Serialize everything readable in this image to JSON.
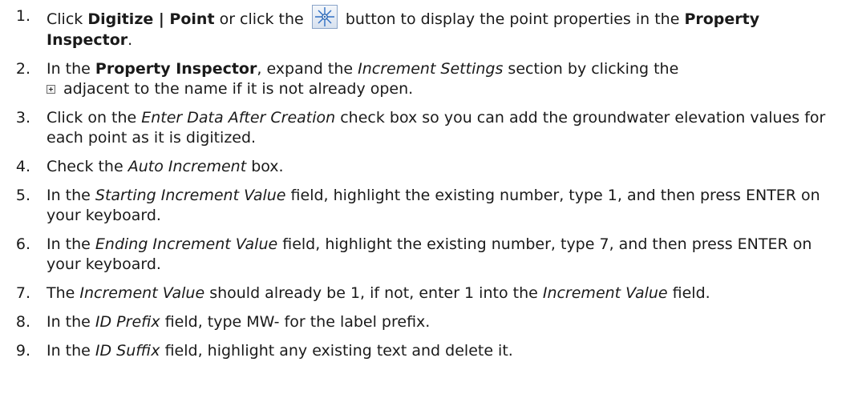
{
  "steps": [
    {
      "num": "1.",
      "t1": "Click ",
      "b1": "Digitize | Point",
      "t2": " or click the ",
      "t3": " button to display the point properties in the ",
      "b2": "Property Inspector",
      "t4": "."
    },
    {
      "num": "2.",
      "t1": "In the ",
      "b1": "Property Inspector",
      "t2": ", expand the ",
      "i1": "Increment Settings",
      "t3": " section by clicking the ",
      "t4": " adjacent to the name if it is not already open."
    },
    {
      "num": "3.",
      "t1": "Click on the ",
      "i1": "Enter Data After Creation",
      "t2": " check box so you can add the groundwater elevation values for each point as it is digitized."
    },
    {
      "num": "4.",
      "t1": "Check the ",
      "i1": "Auto Increment",
      "t2": " box."
    },
    {
      "num": "5.",
      "t1": "In the ",
      "i1": "Starting Increment Value",
      "t2": " field, highlight the existing number, type 1, and then press ENTER on your keyboard."
    },
    {
      "num": "6.",
      "t1": "In the ",
      "i1": "Ending Increment Value",
      "t2": " field, highlight the existing number, type 7, and then press ENTER on your keyboard."
    },
    {
      "num": "7.",
      "t1": "The ",
      "i1": "Increment Value",
      "t2": " should already be 1, if not, enter 1 into the ",
      "i2": "Increment Value",
      "t3": " field."
    },
    {
      "num": "8.",
      "t1": "In the ",
      "i1": "ID Prefix",
      "t2": " field, type MW- for the label prefix."
    },
    {
      "num": "9.",
      "t1": "In the ",
      "i1": "ID Suffix",
      "t2": " field, highlight any existing text and delete it."
    }
  ],
  "icons": {
    "point_button": "digitize-point-icon",
    "expand": "expand-plus-icon"
  }
}
